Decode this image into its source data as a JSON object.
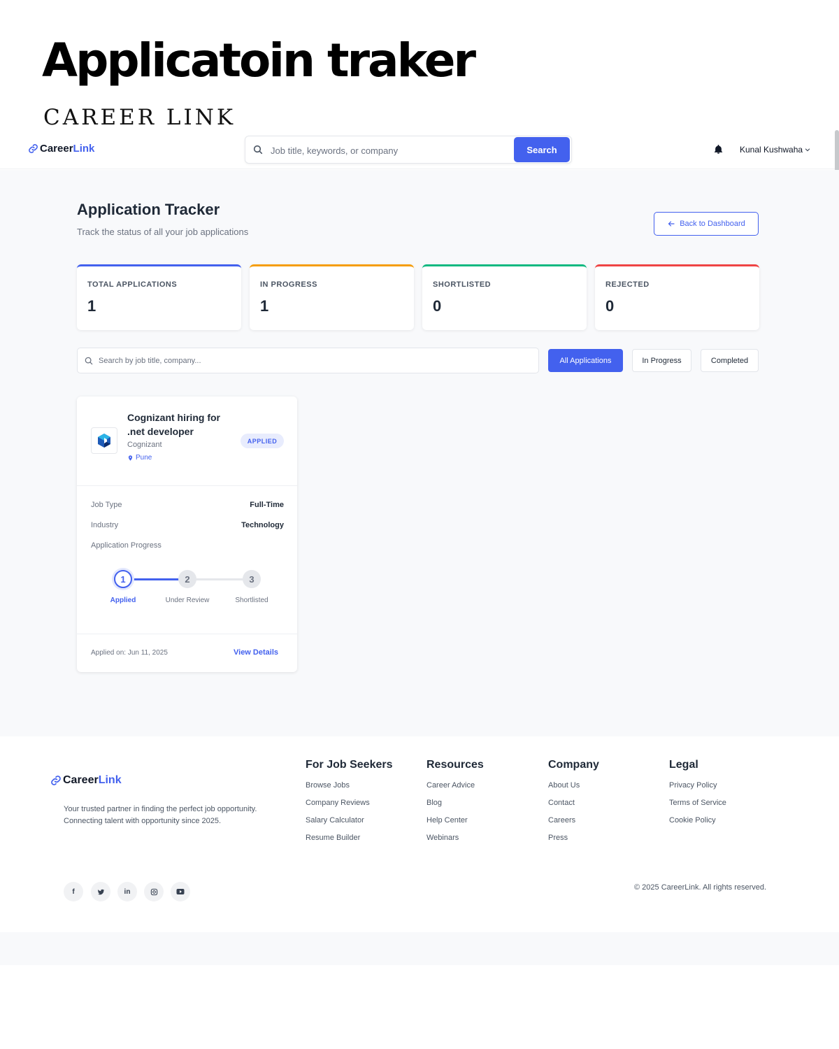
{
  "poster": {
    "title": "Applicatoin traker",
    "subtitle": "CAREER LINK"
  },
  "brand": {
    "part1": "Career",
    "part2": "Link"
  },
  "header": {
    "search_placeholder": "Job title, keywords, or company",
    "search_button": "Search",
    "user_name": "Kunal Kushwaha"
  },
  "page": {
    "title": "Application Tracker",
    "subtitle": "Track the status of all your job applications",
    "back_button": "Back to Dashboard"
  },
  "stats": [
    {
      "label": "TOTAL APPLICATIONS",
      "value": "1",
      "color": "#4361ee"
    },
    {
      "label": "IN PROGRESS",
      "value": "1",
      "color": "#f59e0b"
    },
    {
      "label": "SHORTLISTED",
      "value": "0",
      "color": "#10b981"
    },
    {
      "label": "REJECTED",
      "value": "0",
      "color": "#ef4444"
    }
  ],
  "filters": {
    "search_placeholder": "Search by job title, company...",
    "buttons": [
      "All Applications",
      "In Progress",
      "Completed"
    ],
    "active": "All Applications"
  },
  "application": {
    "title": "Cognizant hiring for .net developer",
    "company": "Cognizant",
    "location": "Pune",
    "status": "APPLIED",
    "details": [
      {
        "key": "Job Type",
        "value": "Full-Time"
      },
      {
        "key": "Industry",
        "value": "Technology"
      }
    ],
    "progress_label": "Application Progress",
    "steps": [
      {
        "num": "1",
        "label": "Applied"
      },
      {
        "num": "2",
        "label": "Under Review"
      },
      {
        "num": "3",
        "label": "Shortlisted"
      }
    ],
    "current_step": 1,
    "applied_on": "Applied on: Jun 11, 2025",
    "view_details": "View Details"
  },
  "footer": {
    "description": "Your trusted partner in finding the perfect job opportunity. Connecting talent with opportunity since 2025.",
    "columns": [
      {
        "title": "For Job Seekers",
        "links": [
          "Browse Jobs",
          "Company Reviews",
          "Salary Calculator",
          "Resume Builder"
        ]
      },
      {
        "title": "Resources",
        "links": [
          "Career Advice",
          "Blog",
          "Help Center",
          "Webinars"
        ]
      },
      {
        "title": "Company",
        "links": [
          "About Us",
          "Contact",
          "Careers",
          "Press"
        ]
      },
      {
        "title": "Legal",
        "links": [
          "Privacy Policy",
          "Terms of Service",
          "Cookie Policy"
        ]
      }
    ],
    "social": [
      "facebook-icon",
      "twitter-icon",
      "linkedin-icon",
      "instagram-icon",
      "youtube-icon"
    ],
    "copyright": "© 2025 CareerLink. All rights reserved."
  },
  "colors": {
    "accent": "#4361ee",
    "page_bg": "#f8f9fb"
  }
}
